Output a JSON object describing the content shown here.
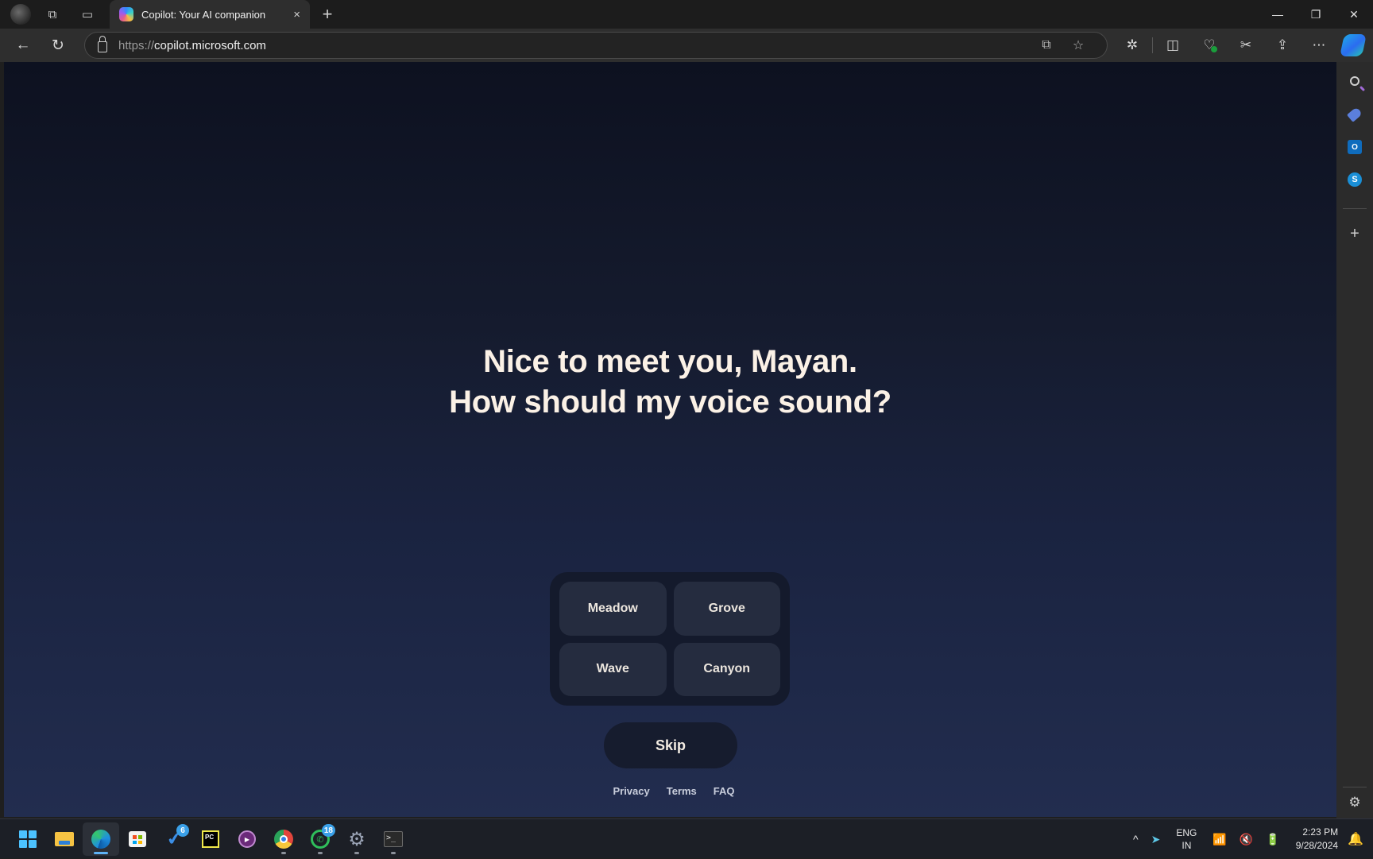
{
  "browser": {
    "tab": {
      "title": "Copilot: Your AI companion",
      "close_glyph": "×",
      "favicon": "copilot-icon"
    },
    "new_tab_glyph": "+",
    "window_controls": {
      "minimize": "—",
      "restore": "❐",
      "close": "✕"
    },
    "address": {
      "scheme": "https://",
      "host": "copilot.microsoft.com"
    },
    "nav": {
      "back": "←",
      "refresh": "↻"
    },
    "omnibox_icons": {
      "open_in_app": "⧉",
      "favorite": "☆"
    },
    "toolbar_icons": {
      "extensions": "✲",
      "split_screen": "◫",
      "browser_essentials": "♡",
      "web_capture": "✂",
      "share": "⇪",
      "more": "⋯"
    }
  },
  "main": {
    "headline_line1": "Nice to meet you, Mayan.",
    "headline_line2": "How should my voice sound?",
    "voice_options": [
      "Meadow",
      "Grove",
      "Wave",
      "Canyon"
    ],
    "skip_label": "Skip",
    "footer_links": [
      "Privacy",
      "Terms",
      "FAQ"
    ]
  },
  "sidebar": {
    "items": [
      {
        "name": "search",
        "label": ""
      },
      {
        "name": "shopping",
        "label": ""
      },
      {
        "name": "outlook",
        "label": "O"
      },
      {
        "name": "skype",
        "label": "S"
      }
    ],
    "add_glyph": "+",
    "settings_glyph": "⚙"
  },
  "taskbar": {
    "badges": {
      "todo": "6",
      "whatsapp": "18"
    },
    "tray": {
      "overflow": "^",
      "language_line1": "ENG",
      "language_line2": "IN",
      "time": "2:23 PM",
      "date": "9/28/2024"
    }
  },
  "colors": {
    "headline": "#fbf1e6",
    "option_bg": "#252c3f",
    "grid_bg": "#141a2c",
    "skip_bg": "#161c2e",
    "bg_top": "#0d1120",
    "bg_bottom": "#222d4f"
  }
}
